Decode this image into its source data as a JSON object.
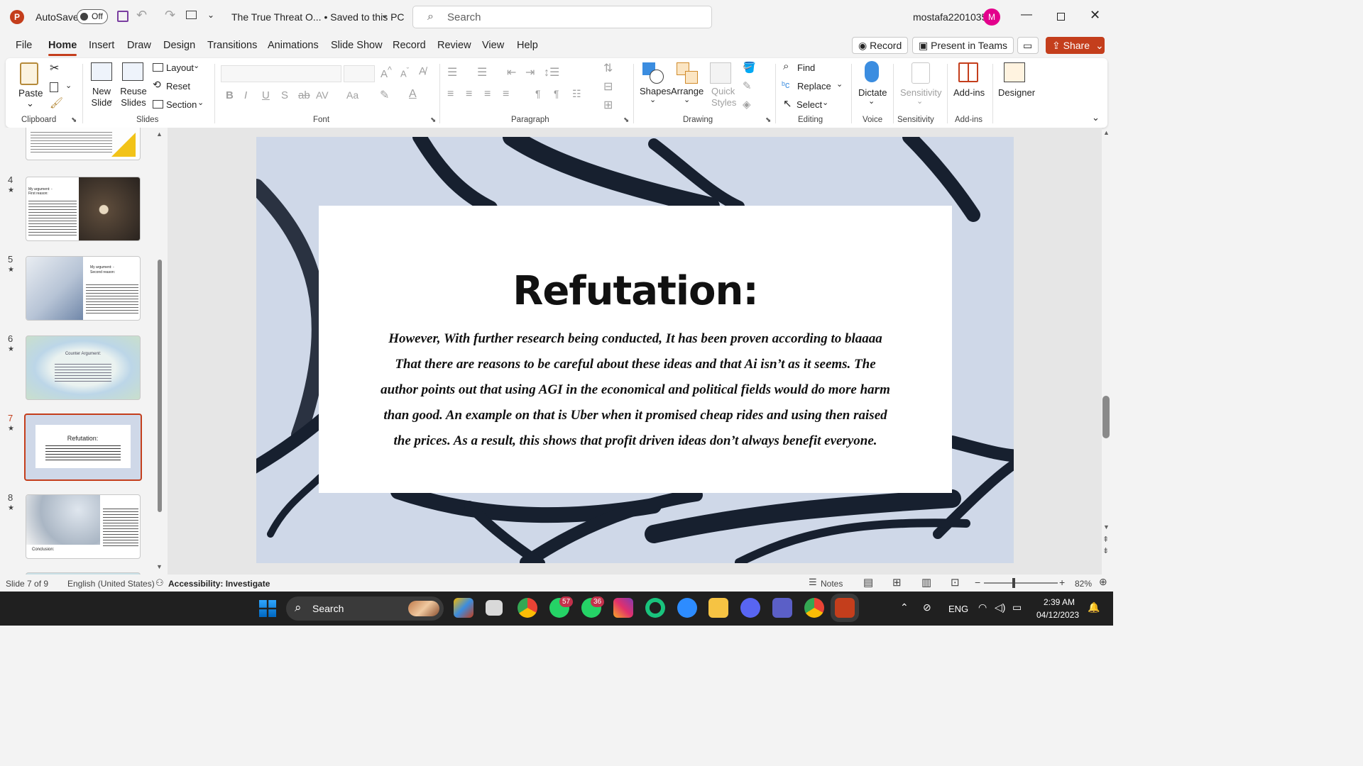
{
  "titlebar": {
    "autosave_label": "AutoSave",
    "autosave_state": "Off",
    "doc_title": "The True Threat O... • Saved to this PC",
    "search_placeholder": "Search",
    "user_name": "mostafa2201035",
    "user_initial": "M"
  },
  "tabs": [
    "File",
    "Home",
    "Insert",
    "Draw",
    "Design",
    "Transitions",
    "Animations",
    "Slide Show",
    "Record",
    "Review",
    "View",
    "Help"
  ],
  "tab_actions": {
    "record": "Record",
    "present": "Present in Teams",
    "share": "Share"
  },
  "ribbon": {
    "clipboard": {
      "paste": "Paste",
      "group": "Clipboard"
    },
    "slides": {
      "new_slide": "New Slide",
      "reuse": "Reuse Slides",
      "layout": "Layout",
      "reset": "Reset",
      "section": "Section",
      "group": "Slides"
    },
    "font": {
      "group": "Font"
    },
    "paragraph": {
      "group": "Paragraph"
    },
    "drawing": {
      "shapes": "Shapes",
      "arrange": "Arrange",
      "quick_styles": "Quick Styles",
      "group": "Drawing"
    },
    "editing": {
      "find": "Find",
      "replace": "Replace",
      "select": "Select",
      "group": "Editing"
    },
    "voice": {
      "dictate": "Dictate",
      "group": "Voice"
    },
    "sensitivity": {
      "label": "Sensitivity",
      "group": "Sensitivity"
    },
    "addins": {
      "label": "Add-ins",
      "group": "Add-ins"
    },
    "designer": {
      "label": "Designer"
    }
  },
  "thumbnails": [
    {
      "num": "4",
      "title": "My argument: -First reason:"
    },
    {
      "num": "5",
      "title": "My argument: -Second reason:"
    },
    {
      "num": "6",
      "title": "Counter Argument:"
    },
    {
      "num": "7",
      "title": "Refutation:"
    },
    {
      "num": "8",
      "title": "Conclusion:"
    }
  ],
  "slide": {
    "title": "Refutation:",
    "body": "However, With further research being conducted, It has been proven according to blaaaa That there are reasons to be careful about these ideas and that Ai isn’t as it seems. The author points out that using AGI in the economical and political fields would do more harm than good. An example on that is Uber when it promised cheap rides and using then raised the prices. As a result, this shows that profit driven ideas don’t always benefit everyone."
  },
  "statusbar": {
    "slide_of": "Slide 7 of 9",
    "language": "English (United States)",
    "accessibility": "Accessibility: Investigate",
    "notes": "Notes",
    "zoom": "82%"
  },
  "taskbar": {
    "search": "Search",
    "whatsapp_badge": "57",
    "whatsapp2_badge": "36",
    "lang": "ENG",
    "time": "2:39 AM",
    "date": "04/12/2023"
  },
  "colors": {
    "accent": "#c43e1c",
    "share": "#c43e1c",
    "slide_bg": "#cfd8e8",
    "brush": "#17202f",
    "avatar": "#e3008c"
  }
}
